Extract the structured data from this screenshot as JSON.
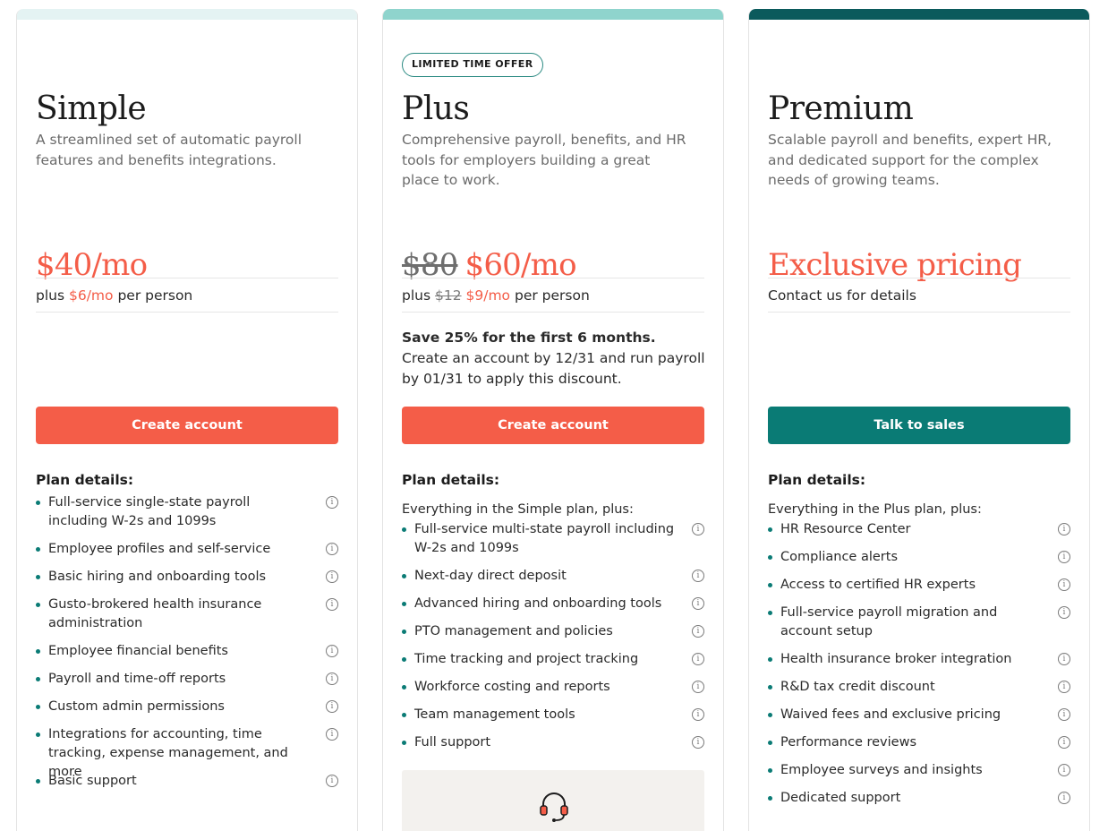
{
  "colors": {
    "accent_coral": "#f45d48",
    "teal": "#0a7b75",
    "simple_bar": "#e4f3f3",
    "plus_bar": "#8fd4cd",
    "premium_bar": "#0b5a5c"
  },
  "plans": {
    "simple": {
      "name": "Simple",
      "description": "A streamlined set of automatic payroll features and benefits integrations.",
      "price": "$40/mo",
      "per_person_prefix": "plus ",
      "per_person_price": "$6/mo",
      "per_person_suffix": " per person",
      "cta": "Create account",
      "details_title": "Plan details:",
      "features": [
        "Full-service single-state payroll including W-2s and 1099s",
        "Employee profiles and self-service",
        "Basic hiring and onboarding tools",
        "Gusto-brokered health insurance administration",
        "Employee financial benefits",
        "Payroll and time-off reports",
        "Custom admin permissions",
        "Integrations for accounting, time tracking, expense management, and more",
        "Basic support"
      ]
    },
    "plus": {
      "badge": "LIMITED TIME OFFER",
      "name": "Plus",
      "description": "Comprehensive payroll, benefits, and HR tools for employers building a great place to work.",
      "price_old": "$80",
      "price": "$60/mo",
      "per_person_prefix": "plus ",
      "per_person_old": "$12",
      "per_person_price": "$9/mo",
      "per_person_suffix": " per person",
      "offer_bold": "Save 25% for the first 6 months.",
      "offer_text": " Create an account by 12/31 and run payroll by 01/31 to apply this discount.",
      "cta": "Create account",
      "details_title": "Plan details:",
      "details_intro": "Everything in the Simple plan, plus:",
      "features": [
        "Full-service multi-state payroll including W-2s and 1099s",
        "Next-day direct deposit",
        "Advanced hiring and onboarding tools",
        "PTO management and policies",
        "Time tracking and project tracking",
        "Workforce costing and reports",
        "Team management tools",
        "Full support"
      ],
      "support_icon": "headset-icon"
    },
    "premium": {
      "name": "Premium",
      "description": "Scalable payroll and benefits, expert HR, and dedicated support for the complex needs of growing teams.",
      "price": "Exclusive pricing",
      "contact": "Contact us for details",
      "cta": "Talk to sales",
      "details_title": "Plan details:",
      "details_intro": "Everything in the Plus plan, plus:",
      "features": [
        "HR Resource Center",
        "Compliance alerts",
        "Access to certified HR experts",
        "Full-service payroll migration and account setup",
        "Health insurance broker integration",
        "R&D tax credit discount",
        "Waived fees and exclusive pricing",
        "Performance reviews",
        "Employee surveys and insights",
        "Dedicated support"
      ]
    }
  },
  "info_glyph": "i"
}
